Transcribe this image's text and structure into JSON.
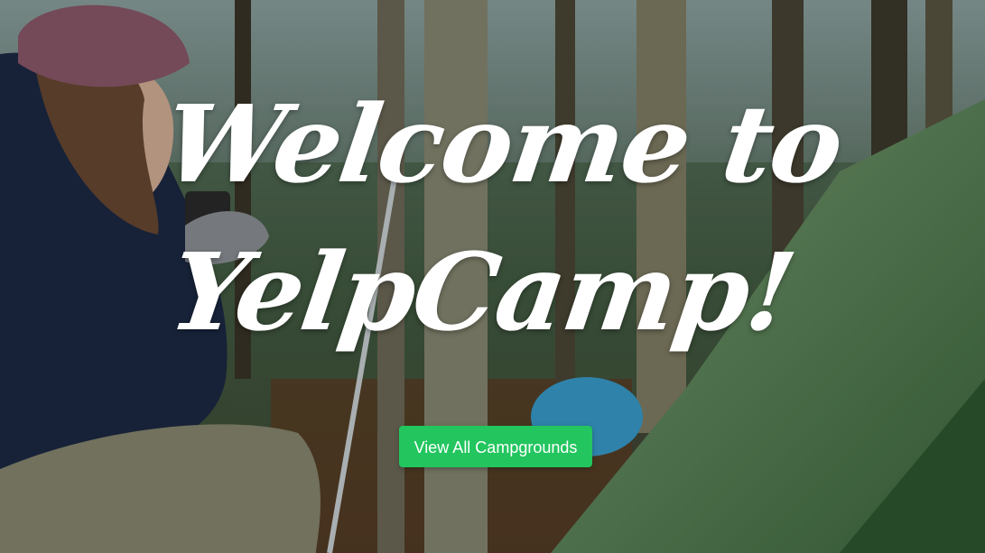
{
  "hero": {
    "title_line1": "Welcome to",
    "title_line2": "YelpCamp!",
    "cta_label": "View All Campgrounds",
    "cta_color": "#22c55e"
  }
}
